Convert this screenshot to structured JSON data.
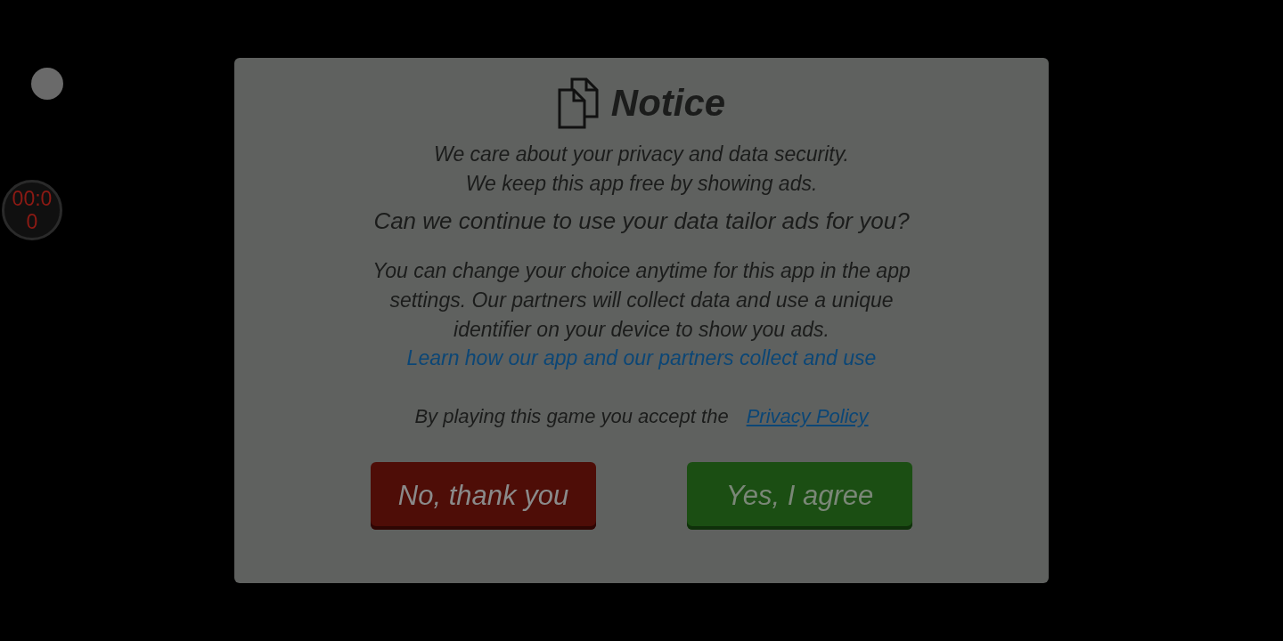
{
  "overlay": {
    "timer": "00:00"
  },
  "dialog": {
    "title": "Notice",
    "intro": [
      "We care about your privacy and data security.",
      "We keep this app free by showing ads."
    ],
    "question": "Can we continue to use your data tailor ads for you?",
    "details": "You can change your choice anytime for this app in the app settings. Our partners will collect data and use a unique identifier on your device to show you ads.",
    "learn_link": "Learn how our app and our partners collect and use",
    "policy_text": "By playing this game you accept the",
    "policy_link": "Privacy Policy",
    "buttons": [
      {
        "label": "No, thank you",
        "kind": "decline"
      },
      {
        "label": "Yes, I agree",
        "kind": "accept"
      }
    ]
  }
}
